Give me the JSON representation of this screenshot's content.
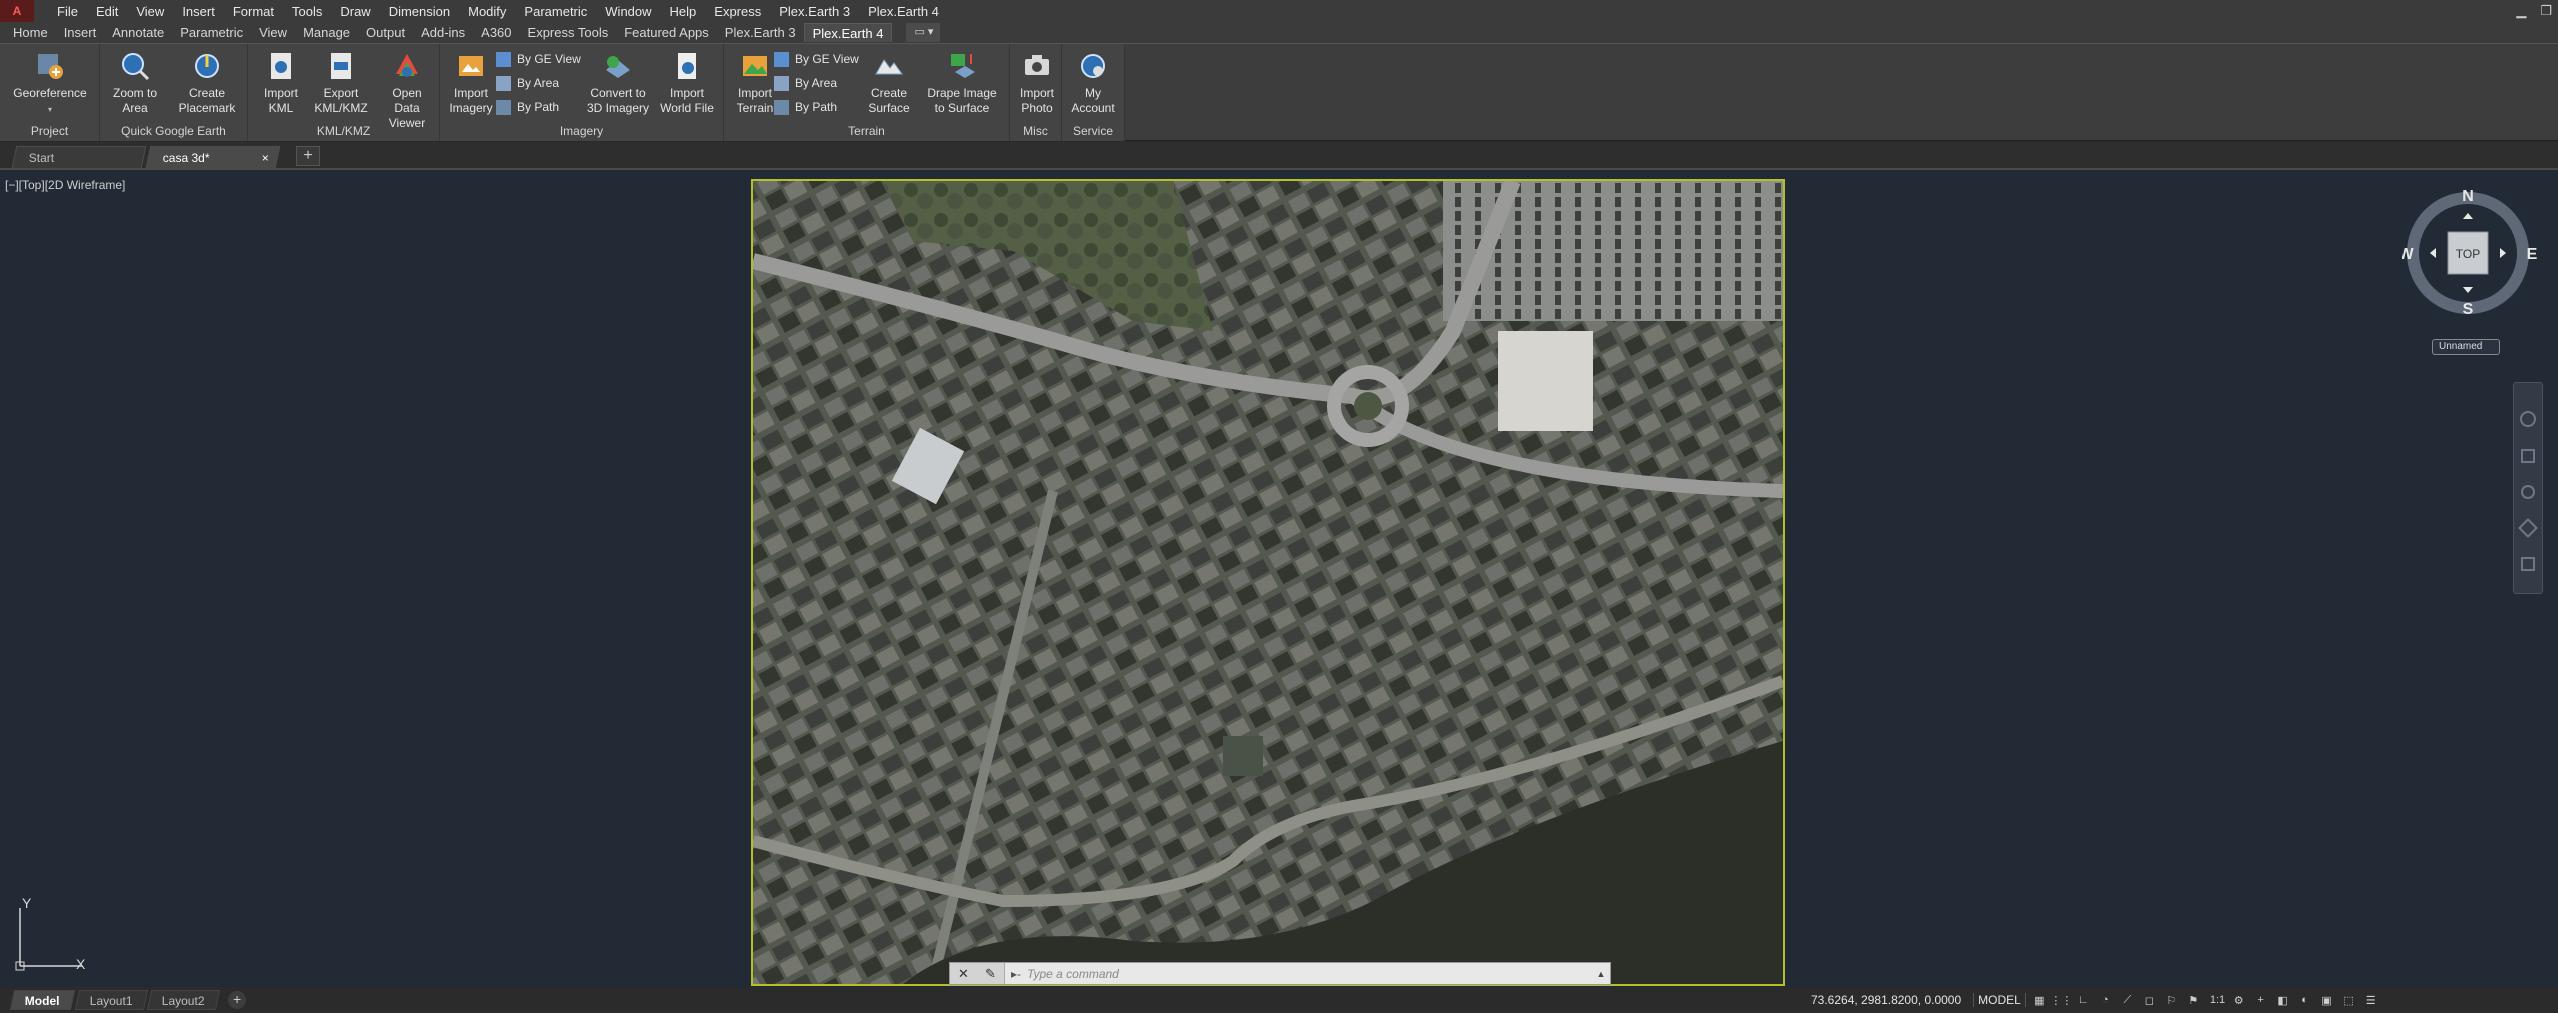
{
  "menubar": {
    "logo": "A",
    "items": [
      "File",
      "Edit",
      "View",
      "Insert",
      "Format",
      "Tools",
      "Draw",
      "Dimension",
      "Modify",
      "Parametric",
      "Window",
      "Help",
      "Express",
      "Plex.Earth 3",
      "Plex.Earth 4"
    ]
  },
  "ribbon_tabs": {
    "items": [
      "Home",
      "Insert",
      "Annotate",
      "Parametric",
      "View",
      "Manage",
      "Output",
      "Add-ins",
      "A360",
      "Express Tools",
      "Featured Apps",
      "Plex.Earth 3",
      "Plex.Earth 4"
    ],
    "active": "Plex.Earth 4"
  },
  "ribbon": {
    "project": {
      "label": "Project",
      "georeference": "Georeference"
    },
    "qge": {
      "label": "Quick Google Earth",
      "zoom": "Zoom to\nArea",
      "placemark": "Create\nPlacemark"
    },
    "kml": {
      "label": "KML/KMZ",
      "import": "Import\nKML",
      "export": "Export\nKML/KMZ",
      "viewer": "Open\nData Viewer"
    },
    "imagery": {
      "label": "Imagery",
      "import": "Import\nImagery",
      "by_ge": "By GE View",
      "by_area": "By Area",
      "by_path": "By Path",
      "convert": "Convert to\n3D Imagery",
      "world": "Import\nWorld File"
    },
    "terrain": {
      "label": "Terrain",
      "import": "Import\nTerrain",
      "by_ge": "By GE View",
      "by_area": "By Area",
      "by_path": "By Path",
      "surface": "Create\nSurface",
      "drape": "Drape Image\nto Surface"
    },
    "misc": {
      "label": "Misc",
      "photo": "Import\nPhoto"
    },
    "service": {
      "label": "Service",
      "account": "My\nAccount"
    }
  },
  "file_tabs": {
    "items": [
      "Start",
      "casa 3d*"
    ],
    "add": "+"
  },
  "viewport": {
    "label": "[−][Top][2D Wireframe]"
  },
  "viewcube": {
    "n": "N",
    "s": "S",
    "e": "E",
    "w": "W",
    "face": "TOP",
    "ucs": "Unnamed"
  },
  "ucs_icon": {
    "x": "X",
    "y": "Y"
  },
  "command_line": {
    "placeholder": "Type a command",
    "prompt": "▸-"
  },
  "layout_tabs": {
    "items": [
      "Model",
      "Layout1",
      "Layout2"
    ],
    "add": "+"
  },
  "statusbar": {
    "coords": "73.6264, 2981.8200, 0.0000",
    "model": "MODEL",
    "scale": "1:1"
  },
  "colors": {
    "accent": "#b6c02a",
    "canvas": "#222a35",
    "ribbon": "#444444"
  }
}
